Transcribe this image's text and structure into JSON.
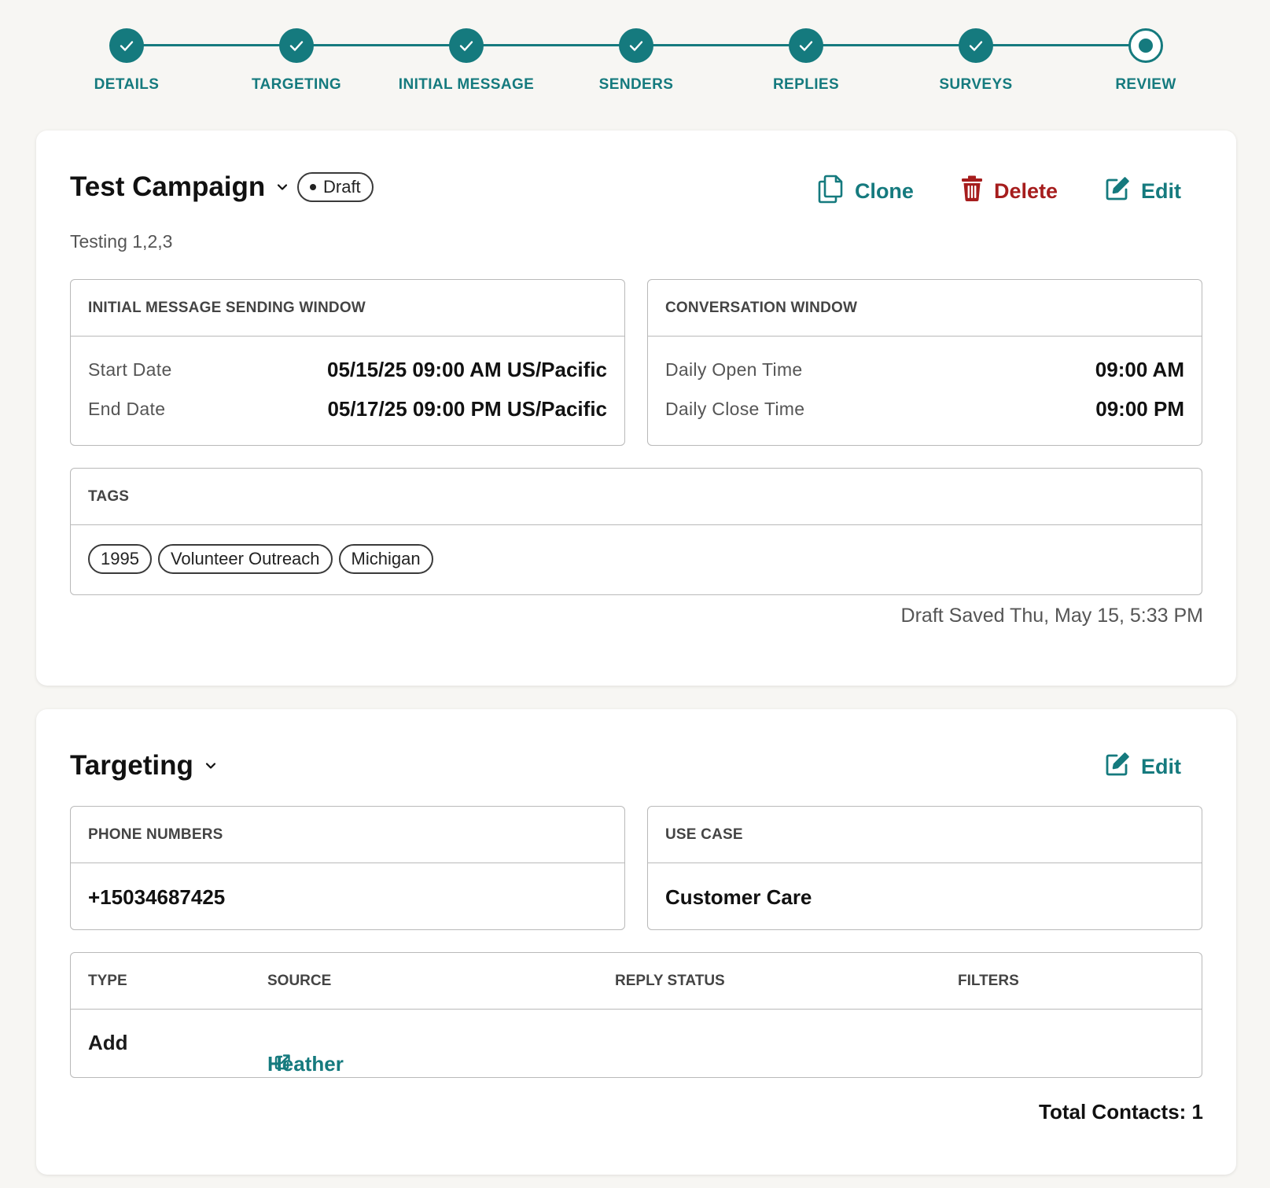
{
  "stepper": {
    "steps": [
      {
        "label": "DETAILS",
        "status": "complete"
      },
      {
        "label": "TARGETING",
        "status": "complete"
      },
      {
        "label": "INITIAL MESSAGE",
        "status": "complete"
      },
      {
        "label": "SENDERS",
        "status": "complete"
      },
      {
        "label": "REPLIES",
        "status": "complete"
      },
      {
        "label": "SURVEYS",
        "status": "complete"
      },
      {
        "label": "REVIEW",
        "status": "current"
      }
    ]
  },
  "campaign": {
    "title": "Test Campaign",
    "status_badge": "Draft",
    "description": "Testing 1,2,3",
    "actions": {
      "clone": "Clone",
      "delete": "Delete",
      "edit": "Edit"
    },
    "sending_window": {
      "header": "INITIAL MESSAGE SENDING WINDOW",
      "start_label": "Start Date",
      "start_value": "05/15/25 09:00 AM US/Pacific",
      "end_label": "End Date",
      "end_value": "05/17/25 09:00 PM US/Pacific"
    },
    "conversation_window": {
      "header": "CONVERSATION WINDOW",
      "open_label": "Daily Open Time",
      "open_value": "09:00 AM",
      "close_label": "Daily Close Time",
      "close_value": "09:00 PM"
    },
    "tags": {
      "header": "TAGS",
      "items": [
        "1995",
        "Volunteer Outreach",
        "Michigan"
      ]
    },
    "saved_note": "Draft Saved Thu, May 15, 5:33 PM"
  },
  "targeting": {
    "title": "Targeting",
    "edit_label": "Edit",
    "phone_numbers": {
      "header": "PHONE NUMBERS",
      "value": "+15034687425"
    },
    "use_case": {
      "header": "USE CASE",
      "value": "Customer Care"
    },
    "table": {
      "headers": {
        "type": "TYPE",
        "source": "SOURCE",
        "reply_status": "REPLY STATUS",
        "filters": "FILTERS"
      },
      "row": {
        "type": "Add",
        "source": "Heather",
        "reply_status": "",
        "filters": ""
      }
    },
    "total_contacts": "Total Contacts: 1"
  },
  "colors": {
    "accent": "#157a7e",
    "danger": "#a61d1d",
    "background": "#f7f6f3"
  },
  "icons": {
    "step_complete": "check-icon",
    "step_current": "radio-dot-icon",
    "clone": "copy-icon",
    "delete": "trash-icon",
    "edit": "pencil-square-icon",
    "title_toggle": "chevron-down-icon",
    "source_link": "external-link-icon"
  }
}
